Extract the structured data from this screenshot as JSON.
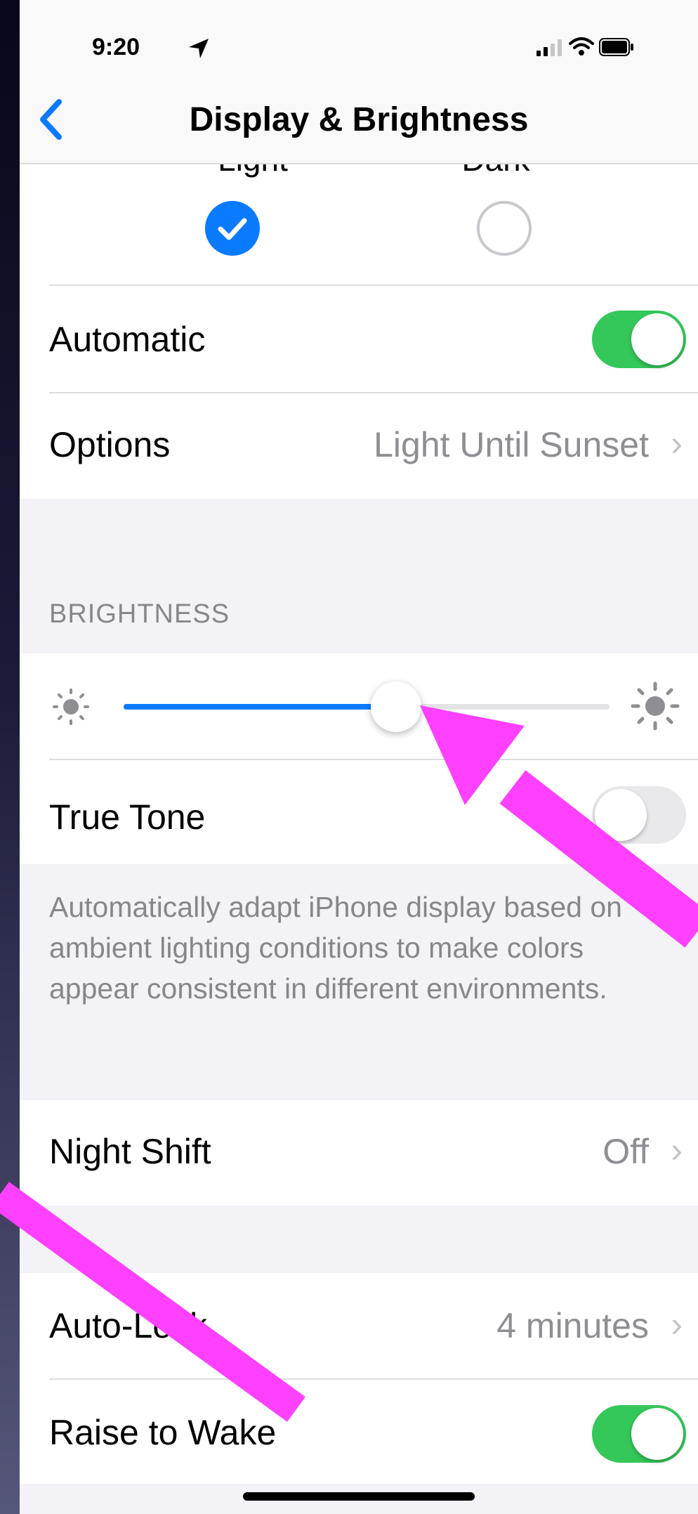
{
  "status_bar": {
    "time": "9:20",
    "location_icon": "location-arrow-icon",
    "signal_icon": "cellular-signal-icon",
    "wifi_icon": "wifi-icon",
    "battery_icon": "battery-icon"
  },
  "nav": {
    "back_icon": "chevron-left-icon",
    "title": "Display & Brightness"
  },
  "appearance": {
    "light_label": "Light",
    "dark_label": "Dark",
    "selected": "Light"
  },
  "automatic": {
    "label": "Automatic",
    "on": true
  },
  "options": {
    "label": "Options",
    "value": "Light Until Sunset"
  },
  "brightness": {
    "header": "BRIGHTNESS",
    "level": 0.56,
    "min_icon": "sun-small-icon",
    "max_icon": "sun-large-icon"
  },
  "true_tone": {
    "label": "True Tone",
    "on": false,
    "footer": "Automatically adapt iPhone display based on ambient lighting conditions to make colors appear consistent in different environments."
  },
  "night_shift": {
    "label": "Night Shift",
    "value": "Off"
  },
  "auto_lock": {
    "label": "Auto-Lock",
    "value": "4 minutes"
  },
  "raise_to_wake": {
    "label": "Raise to Wake",
    "on": true
  },
  "colors": {
    "accent_blue": "#0a7aff",
    "toggle_green": "#34c759",
    "annotation_magenta": "#ff40ff"
  }
}
